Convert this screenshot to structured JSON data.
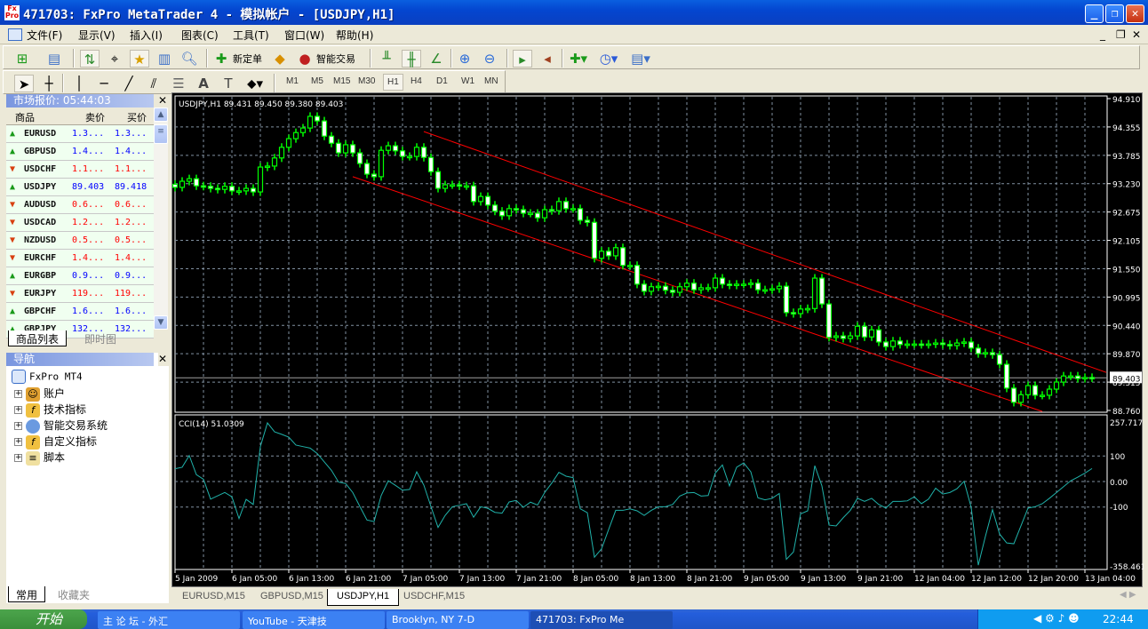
{
  "window": {
    "title": "471703: FxPro MetaTrader 4 - 模拟帐户 - [USDJPY,H1]",
    "icon_text": "Fx Pro",
    "controls": [
      "minimize",
      "maximize",
      "close"
    ]
  },
  "menu": [
    "文件(F)",
    "显示(V)",
    "插入(I)",
    "图表(C)",
    "工具(T)",
    "窗口(W)",
    "帮助(H)"
  ],
  "toolbar": {
    "new_order": "新定单",
    "expert_advisors": "智能交易",
    "timeframes": [
      "M1",
      "M5",
      "M15",
      "M30",
      "H1",
      "H4",
      "D1",
      "W1",
      "MN"
    ],
    "active_timeframe": "H1"
  },
  "market_watch": {
    "title": "市场报价: 05:44:03",
    "columns": [
      "商品",
      "卖价",
      "买价"
    ],
    "rows": [
      {
        "symbol": "EURUSD",
        "bid": "1.3...",
        "ask": "1.3...",
        "dir": "up"
      },
      {
        "symbol": "GBPUSD",
        "bid": "1.4...",
        "ask": "1.4...",
        "dir": "up"
      },
      {
        "symbol": "USDCHF",
        "bid": "1.1...",
        "ask": "1.1...",
        "dir": "down"
      },
      {
        "symbol": "USDJPY",
        "bid": "89.403",
        "ask": "89.418",
        "dir": "up"
      },
      {
        "symbol": "AUDUSD",
        "bid": "0.6...",
        "ask": "0.6...",
        "dir": "down"
      },
      {
        "symbol": "USDCAD",
        "bid": "1.2...",
        "ask": "1.2...",
        "dir": "down"
      },
      {
        "symbol": "NZDUSD",
        "bid": "0.5...",
        "ask": "0.5...",
        "dir": "down"
      },
      {
        "symbol": "EURCHF",
        "bid": "1.4...",
        "ask": "1.4...",
        "dir": "down"
      },
      {
        "symbol": "EURGBP",
        "bid": "0.9...",
        "ask": "0.9...",
        "dir": "up"
      },
      {
        "symbol": "EURJPY",
        "bid": "119...",
        "ask": "119...",
        "dir": "down"
      },
      {
        "symbol": "GBPCHF",
        "bid": "1.6...",
        "ask": "1.6...",
        "dir": "up"
      },
      {
        "symbol": "GBPJPY",
        "bid": "132...",
        "ask": "132...",
        "dir": "up"
      }
    ],
    "tabs": [
      "商品列表",
      "即时图"
    ]
  },
  "navigator": {
    "title": "导航",
    "root": "FxPro MT4",
    "items": [
      "账户",
      "技术指标",
      "智能交易系统",
      "自定义指标",
      "脚本"
    ],
    "tabs": [
      "常用",
      "收藏夹"
    ]
  },
  "chart_tabs": [
    {
      "label": "EURUSD,M15"
    },
    {
      "label": "GBPUSD,M15"
    },
    {
      "label": "USDJPY,H1",
      "active": true
    },
    {
      "label": "USDCHF,M15"
    }
  ],
  "chart_data": [
    {
      "type": "candlestick",
      "title": "USDJPY,H1  89.431 89.450 89.380 89.403",
      "symbol": "USDJPY",
      "timeframe": "H1",
      "current_price": "89.403",
      "ylim": [
        88.76,
        94.91
      ],
      "y_ticks": [
        "94.910",
        "94.355",
        "93.785",
        "93.230",
        "92.675",
        "92.105",
        "91.550",
        "90.995",
        "90.440",
        "89.870",
        "89.315",
        "88.760"
      ],
      "x_ticks": [
        "5 Jan 2009",
        "6 Jan 05:00",
        "6 Jan 13:00",
        "6 Jan 21:00",
        "7 Jan 05:00",
        "7 Jan 13:00",
        "7 Jan 21:00",
        "8 Jan 05:00",
        "8 Jan 13:00",
        "8 Jan 21:00",
        "9 Jan 05:00",
        "9 Jan 13:00",
        "9 Jan 21:00",
        "12 Jan 04:00",
        "12 Jan 12:00",
        "12 Jan 20:00",
        "13 Jan 04:00"
      ],
      "grid": true,
      "colors": {
        "background": "#000000",
        "candle": "#00ff00",
        "bear_body": "#ffffff",
        "trendline": "#ff0000",
        "grid": "#8090a0"
      },
      "closes": [
        93.16,
        93.28,
        93.33,
        93.19,
        93.18,
        93.14,
        93.12,
        93.18,
        93.09,
        93.09,
        93.14,
        93.07,
        93.56,
        93.58,
        93.74,
        93.95,
        94.12,
        94.24,
        94.33,
        94.56,
        94.47,
        94.17,
        94.03,
        93.84,
        94.0,
        93.84,
        93.63,
        93.42,
        93.37,
        93.89,
        93.98,
        93.88,
        93.77,
        93.77,
        93.95,
        93.75,
        93.47,
        93.14,
        93.21,
        93.21,
        93.19,
        93.19,
        92.88,
        92.98,
        92.81,
        92.69,
        92.6,
        92.74,
        92.72,
        92.65,
        92.65,
        92.56,
        92.72,
        92.7,
        92.88,
        92.74,
        92.74,
        92.51,
        92.47,
        91.76,
        91.9,
        91.81,
        91.97,
        91.62,
        91.62,
        91.25,
        91.11,
        91.2,
        91.21,
        91.13,
        91.09,
        91.2,
        91.27,
        91.14,
        91.18,
        91.18,
        91.37,
        91.25,
        91.23,
        91.25,
        91.25,
        91.27,
        91.14,
        91.14,
        91.16,
        91.21,
        90.69,
        90.67,
        90.76,
        90.77,
        91.37,
        90.86,
        90.2,
        90.23,
        90.18,
        90.23,
        90.42,
        90.21,
        90.35,
        90.11,
        90.02,
        90.13,
        90.06,
        90.07,
        90.07,
        90.06,
        90.07,
        90.09,
        90.06,
        90.04,
        90.09,
        90.11,
        89.99,
        89.88,
        89.9,
        89.86,
        89.67,
        89.2,
        88.92,
        89.07,
        89.25,
        89.06,
        89.06,
        89.18,
        89.32,
        89.44,
        89.44,
        89.39,
        89.41,
        89.4
      ],
      "trendlines": [
        {
          "from": [
            35,
            94.26
          ],
          "to": [
            131,
            89.51
          ]
        },
        {
          "from": [
            25,
            93.37
          ],
          "to": [
            122,
            88.74
          ]
        }
      ]
    },
    {
      "type": "line",
      "title": "CCI(14) 51.0309",
      "ylim": [
        -358.4615,
        257.7171
      ],
      "y_ticks": [
        "257.7171",
        "100",
        "0.00",
        "-100",
        "-358.461"
      ],
      "levels": [
        100,
        0,
        -100
      ],
      "color": "#20b2aa",
      "values": [
        50,
        56,
        102,
        27,
        9,
        -69,
        -56,
        -43,
        -60,
        -145,
        -70,
        -90,
        137,
        230,
        195,
        185,
        174,
        143,
        137,
        131,
        110,
        77,
        44,
        -2,
        -8,
        -43,
        -98,
        -151,
        -157,
        -55,
        3,
        -15,
        -34,
        -31,
        38,
        -14,
        -98,
        -180,
        -133,
        -99,
        -93,
        -87,
        -140,
        -99,
        -105,
        -121,
        -124,
        -80,
        -74,
        -101,
        -81,
        -92,
        -43,
        -6,
        36,
        21,
        15,
        -107,
        -122,
        -297,
        -264,
        -188,
        -113,
        -113,
        -107,
        -115,
        -133,
        -113,
        -99,
        -99,
        -90,
        -57,
        -45,
        -43,
        -57,
        -55,
        33,
        65,
        -17,
        56,
        73,
        38,
        -64,
        -72,
        -66,
        -47,
        -305,
        -276,
        -127,
        -115,
        62,
        -17,
        -171,
        -174,
        -142,
        -113,
        -66,
        -78,
        -66,
        -90,
        -104,
        -78,
        -78,
        -76,
        -60,
        -87,
        -69,
        -26,
        -49,
        -43,
        -28,
        1,
        -101,
        -328,
        -215,
        -110,
        -206,
        -241,
        -244,
        -174,
        -104,
        -99,
        -87,
        -66,
        -43,
        -20,
        3,
        17,
        33,
        51
      ]
    }
  ],
  "taskbar": {
    "start": "开始",
    "tasks": [
      "主 论 坛 - 外汇",
      "YouTube - 天津技",
      "Brooklyn, NY 7-D",
      "471703: FxPro Me"
    ],
    "clock": "22:44"
  }
}
